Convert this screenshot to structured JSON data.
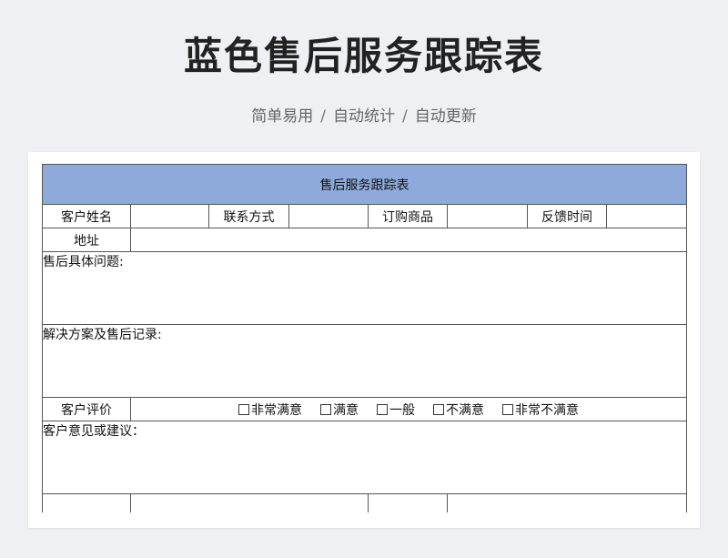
{
  "header": {
    "title": "蓝色售后服务跟踪表",
    "subtitle": [
      "简单易用",
      "自动统计",
      "自动更新"
    ],
    "separator": "/"
  },
  "form": {
    "banner": "售后服务跟踪表",
    "row1": {
      "customer_name": "客户姓名",
      "contact": "联系方式",
      "product": "订购商品",
      "feedback_time": "反馈时间"
    },
    "address": "地址",
    "issue": "售后具体问题:",
    "solution": "解决方案及售后记录:",
    "rating": {
      "label": "客户评价",
      "options": [
        "非常满意",
        "满意",
        "一般",
        "不满意",
        "非常不满意"
      ]
    },
    "suggestion": "客户意见或建议："
  },
  "colors": {
    "banner": "#8eaadb",
    "border": "#555555"
  }
}
